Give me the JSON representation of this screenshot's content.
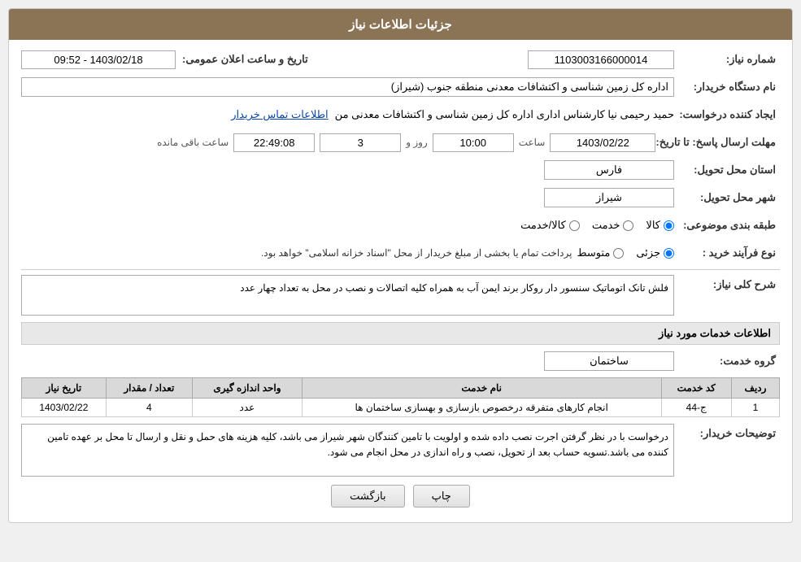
{
  "page": {
    "title": "جزئیات اطلاعات نیاز"
  },
  "fields": {
    "shomareNiaz_label": "شماره نیاز:",
    "shomareNiaz_value": "1103003166000014",
    "namDastgah_label": "نام دستگاه خریدار:",
    "namDastgah_value": "اداره کل زمین شناسی و اکتشافات معدنی منطقه جنوب (شیراز)",
    "ijadKonande_label": "ایجاد کننده درخواست:",
    "ijadKonande_value": "حمید رحیمی نیا کارشناس اداری اداره کل زمین شناسی و اکتشافات معدنی من",
    "ijadKonande_link": "اطلاعات تماس خریدار",
    "mohlat_label": "مهلت ارسال پاسخ: تا تاریخ:",
    "mohlat_date": "1403/02/22",
    "mohlat_saat": "10:00",
    "mohlat_roz": "3",
    "mohlat_saat_label": "ساعت",
    "mohlat_roz_label": "روز و",
    "mohlat_baqi": "22:49:08",
    "mohlat_baqi_label": "ساعت باقی مانده",
    "ostan_label": "استان محل تحویل:",
    "ostan_value": "فارس",
    "shahr_label": "شهر محل تحویل:",
    "shahr_value": "شیراز",
    "tabaqe_label": "طبقه بندی موضوعی:",
    "tabaqe_options": [
      "کالا",
      "خدمت",
      "کالا/خدمت"
    ],
    "tabaqe_selected": "کالا",
    "naveFarayand_label": "نوع فرآیند خرید :",
    "naveFarayand_options": [
      "جزئی",
      "متوسط"
    ],
    "naveFarayand_selected": "جزئی",
    "naveFarayand_note": "پرداخت تمام یا بخشی از مبلغ خریدار از محل \"اسناد خزانه اسلامی\" خواهد بود.",
    "sharh_label": "شرح کلی نیاز:",
    "sharh_value": "فلش تانک اتوماتیک سنسور دار روکار برند ایمن آب به همراه کلیه اتصالات و نصب در محل به تعداد چهار عدد",
    "khadamat_title": "اطلاعات خدمات مورد نیاز",
    "grohe_label": "گروه خدمت:",
    "grohe_value": "ساختمان",
    "table_headers": [
      "ردیف",
      "کد خدمت",
      "نام خدمت",
      "واحد اندازه گیری",
      "تعداد / مقدار",
      "تاریخ نیاز"
    ],
    "table_rows": [
      {
        "radif": "1",
        "kodKhedmat": "ج-44",
        "namKhedmat": "انجام کارهای متفرقه درخصوص بازسازی و بهسازی ساختمان ها",
        "vahed": "عدد",
        "tedad": "4",
        "tarikh": "1403/02/22"
      }
    ],
    "tawzih_label": "توضیحات خریدار:",
    "tawzih_value": "درخواست با در نظر گرفتن اجرت نصب داده شده و اولویت با تامین کنندگان شهر شیراز می باشد، کلیه هزینه های حمل و نقل و ارسال تا محل بر عهده تامین کننده می باشد.تسویه حساب بعد از تحویل، نصب و راه اندازی در محل انجام می شود.",
    "btn_bazgasht": "بازگشت",
    "btn_chap": "چاپ",
    "tarikhSaatAelan_label": "تاریخ و ساعت اعلان عمومی:",
    "tarikhSaatAelan_value": "1403/02/18 - 09:52"
  }
}
